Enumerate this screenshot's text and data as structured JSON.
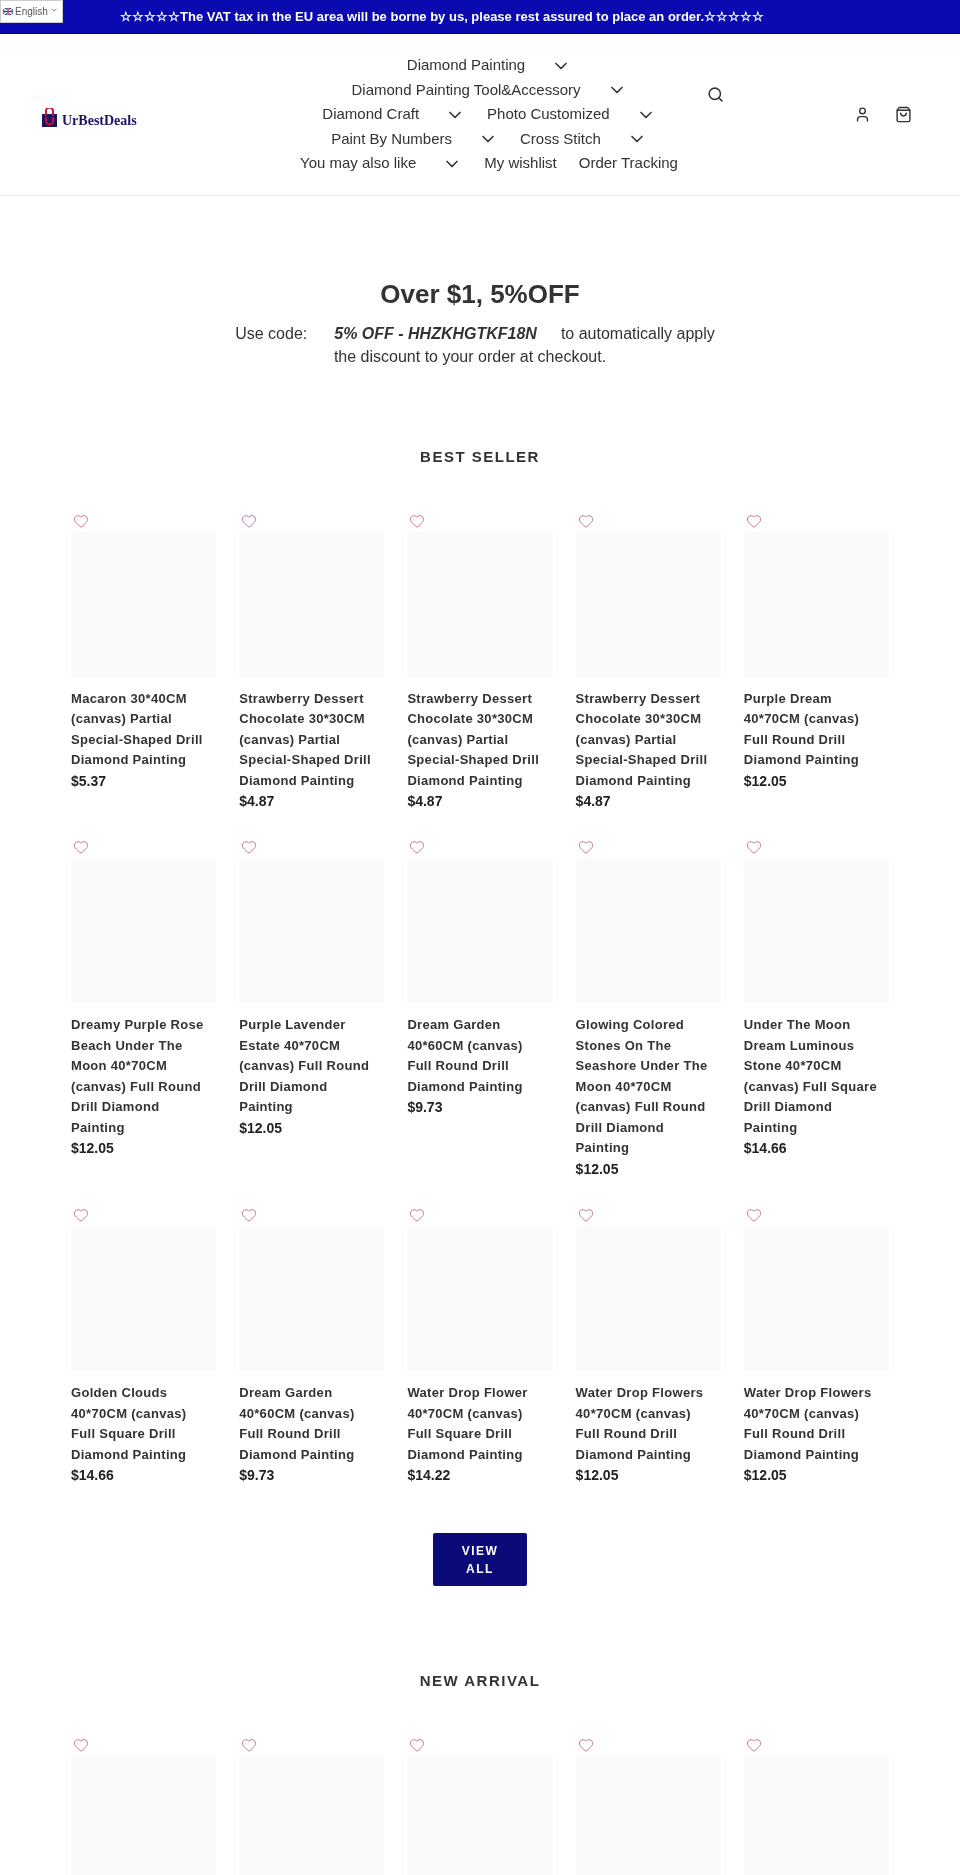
{
  "language_picker": {
    "label": "English"
  },
  "announcement": "☆☆☆☆☆The VAT tax in the EU area will be borne by us, please rest assured to place an order.☆☆☆☆☆",
  "logo": {
    "text": "UrBestDeals"
  },
  "nav": {
    "items": [
      {
        "label": "Diamond Painting",
        "has_dropdown": true
      },
      {
        "label": "Diamond Painting Tool&Accessory",
        "has_dropdown": true
      },
      {
        "label": "Diamond Craft",
        "has_dropdown": true
      },
      {
        "label": "Photo Customized",
        "has_dropdown": true
      },
      {
        "label": "Paint By Numbers",
        "has_dropdown": true
      },
      {
        "label": "Cross Stitch",
        "has_dropdown": true
      },
      {
        "label": "You may also like",
        "has_dropdown": true
      },
      {
        "label": "My wishlist",
        "has_dropdown": false
      },
      {
        "label": "Order Tracking",
        "has_dropdown": false
      }
    ]
  },
  "promo": {
    "title": "Over $1, 5%OFF",
    "prefix": "Use code:",
    "code": "5% OFF - HHZKHGTKF18N",
    "suffix": "to automatically apply",
    "second_line": "the discount to your order at checkout."
  },
  "sections": [
    {
      "title": "BEST SELLER",
      "products": [
        {
          "title": "Macaron 30*40CM (canvas) Partial Special-Shaped Drill Diamond Painting",
          "price": "$5.37"
        },
        {
          "title": "Strawberry Dessert Chocolate 30*30CM (canvas) Partial Special-Shaped Drill Diamond Painting",
          "price": "$4.87"
        },
        {
          "title": "Strawberry Dessert Chocolate 30*30CM (canvas) Partial Special-Shaped Drill Diamond Painting",
          "price": "$4.87"
        },
        {
          "title": "Strawberry Dessert Chocolate 30*30CM (canvas) Partial Special-Shaped Drill Diamond Painting",
          "price": "$4.87"
        },
        {
          "title": "Purple Dream 40*70CM (canvas) Full Round Drill Diamond Painting",
          "price": "$12.05"
        },
        {
          "title": "Dreamy Purple Rose Beach Under The Moon 40*70CM (canvas) Full Round Drill Diamond Painting",
          "price": "$12.05"
        },
        {
          "title": "Purple Lavender Estate 40*70CM (canvas) Full Round Drill Diamond Painting",
          "price": "$12.05"
        },
        {
          "title": "Dream Garden 40*60CM (canvas) Full Round Drill Diamond Painting",
          "price": "$9.73"
        },
        {
          "title": "Glowing Colored Stones On The Seashore Under The Moon 40*70CM (canvas) Full Round Drill Diamond Painting",
          "price": "$12.05"
        },
        {
          "title": "Under The Moon Dream Luminous Stone 40*70CM (canvas) Full Square Drill Diamond Painting",
          "price": "$14.66"
        },
        {
          "title": "Golden Clouds 40*70CM (canvas) Full Square Drill Diamond Painting",
          "price": "$14.66"
        },
        {
          "title": "Dream Garden 40*60CM (canvas) Full Round Drill Diamond Painting",
          "price": "$9.73"
        },
        {
          "title": "Water Drop Flower 40*70CM (canvas) Full Square Drill Diamond Painting",
          "price": "$14.22"
        },
        {
          "title": "Water Drop Flowers 40*70CM (canvas) Full Round Drill Diamond Painting",
          "price": "$12.05"
        },
        {
          "title": "Water Drop Flowers 40*70CM (canvas) Full Round Drill Diamond Painting",
          "price": "$12.05"
        }
      ],
      "button": "VIEW ALL"
    },
    {
      "title": "NEW ARRIVAL",
      "products": [
        {
          "kind": "placeholder"
        },
        {
          "kind": "placeholder"
        },
        {
          "kind": "placeholder"
        },
        {
          "kind": "placeholder"
        },
        {
          "kind": "placeholder"
        }
      ]
    }
  ]
}
